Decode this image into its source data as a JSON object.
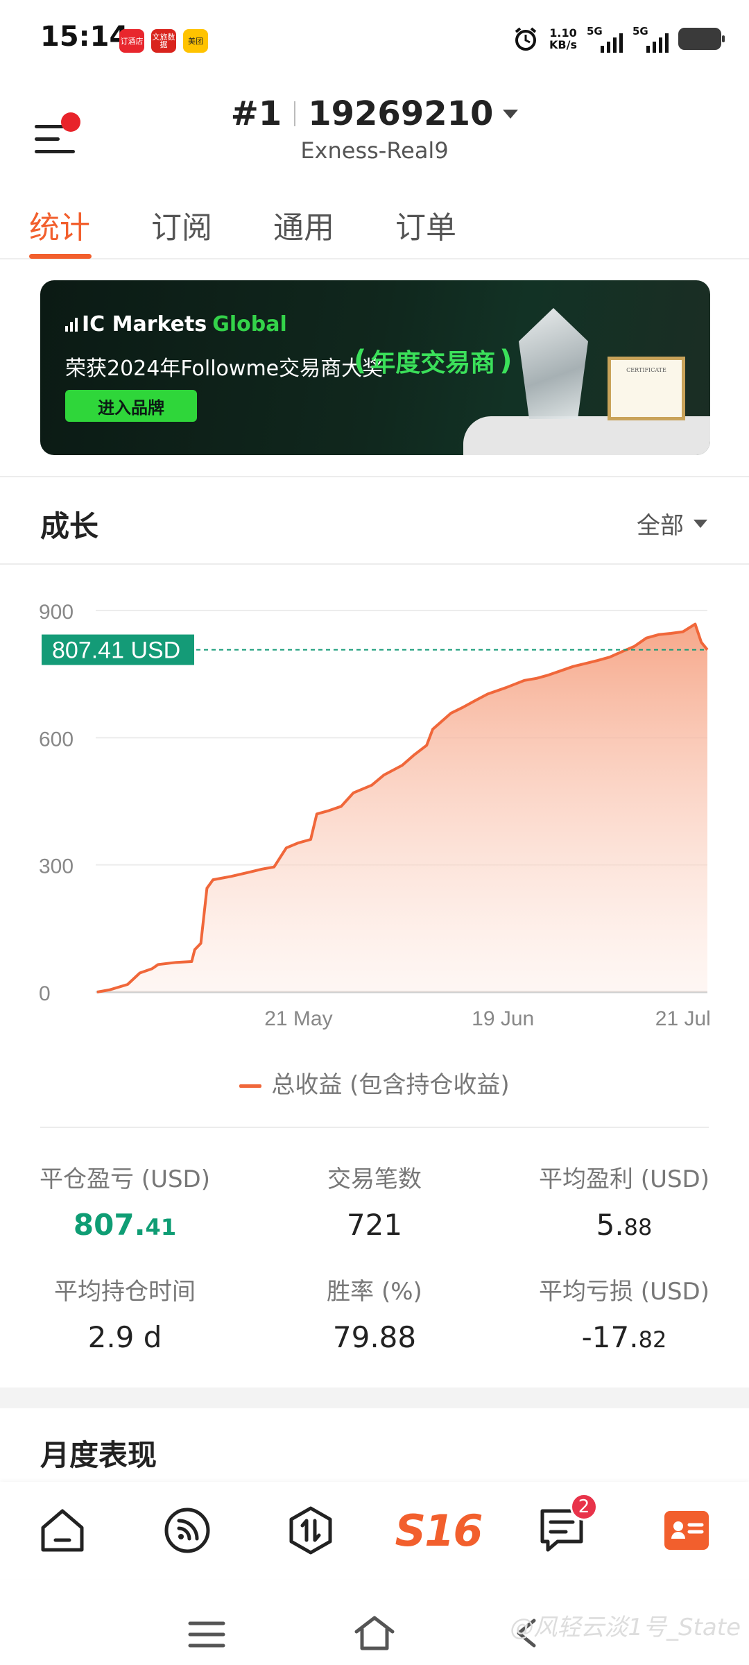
{
  "status_bar": {
    "time": "15:14",
    "apps": [
      {
        "name": "订酒店",
        "color": "#e8262d"
      },
      {
        "name": "文旅数据",
        "color": "#d9241d"
      },
      {
        "name": "美团",
        "color": "#ffc300"
      }
    ],
    "net_speed_value": "1.10",
    "net_speed_unit": "KB/s",
    "sim1": "5G",
    "sim2": "5G"
  },
  "header": {
    "account_index": "#1",
    "account_number": "19269210",
    "server": "Exness-Real9"
  },
  "tabs": [
    {
      "label": "统计",
      "active": true
    },
    {
      "label": "订阅",
      "active": false
    },
    {
      "label": "通用",
      "active": false
    },
    {
      "label": "订单",
      "active": false
    }
  ],
  "banner": {
    "brand_prefix": "IC Markets",
    "brand_suffix": "Global",
    "text": "荣获2024年Followme交易商大奖",
    "award": "年度交易商",
    "button": "进入品牌",
    "certificate_title": "CERTIFICATE"
  },
  "growth": {
    "title": "成长",
    "filter": "全部",
    "current_label": "807.41 USD",
    "legend": "总收益 (包含持仓收益)"
  },
  "chart_data": {
    "type": "area",
    "y_ticks": [
      0,
      300,
      600,
      900
    ],
    "ylim": [
      0,
      900
    ],
    "x_tick_labels": [
      "21 May",
      "19 Jun",
      "21 Jul"
    ],
    "x_tick_positions": [
      0.33,
      0.665,
      0.96
    ],
    "current_value": 807.41,
    "series": [
      {
        "name": "总收益 (包含持仓收益)",
        "color": "#f0673a",
        "points": [
          [
            0.0,
            0
          ],
          [
            0.02,
            5
          ],
          [
            0.05,
            18
          ],
          [
            0.07,
            45
          ],
          [
            0.09,
            55
          ],
          [
            0.1,
            65
          ],
          [
            0.13,
            70
          ],
          [
            0.155,
            72
          ],
          [
            0.16,
            100
          ],
          [
            0.17,
            115
          ],
          [
            0.18,
            245
          ],
          [
            0.19,
            265
          ],
          [
            0.22,
            273
          ],
          [
            0.25,
            283
          ],
          [
            0.27,
            290
          ],
          [
            0.29,
            295
          ],
          [
            0.31,
            340
          ],
          [
            0.33,
            352
          ],
          [
            0.35,
            360
          ],
          [
            0.36,
            420
          ],
          [
            0.38,
            428
          ],
          [
            0.4,
            438
          ],
          [
            0.42,
            470
          ],
          [
            0.45,
            488
          ],
          [
            0.47,
            512
          ],
          [
            0.5,
            535
          ],
          [
            0.52,
            560
          ],
          [
            0.54,
            582
          ],
          [
            0.55,
            620
          ],
          [
            0.58,
            658
          ],
          [
            0.6,
            672
          ],
          [
            0.62,
            688
          ],
          [
            0.64,
            703
          ],
          [
            0.67,
            718
          ],
          [
            0.7,
            735
          ],
          [
            0.72,
            740
          ],
          [
            0.74,
            748
          ],
          [
            0.76,
            758
          ],
          [
            0.78,
            768
          ],
          [
            0.8,
            775
          ],
          [
            0.82,
            782
          ],
          [
            0.84,
            790
          ],
          [
            0.86,
            803
          ],
          [
            0.88,
            815
          ],
          [
            0.9,
            835
          ],
          [
            0.92,
            843
          ],
          [
            0.94,
            846
          ],
          [
            0.96,
            850
          ],
          [
            0.98,
            868
          ],
          [
            0.99,
            825
          ],
          [
            1.0,
            807.41
          ]
        ]
      }
    ]
  },
  "stats": [
    {
      "label": "平仓盈亏 (USD)",
      "value_main": "807.",
      "value_small": "41",
      "positive": true
    },
    {
      "label": "交易笔数",
      "value_main": "721",
      "value_small": "",
      "positive": false
    },
    {
      "label": "平均盈利 (USD)",
      "value_main": "5.",
      "value_small": "88",
      "positive": false
    },
    {
      "label": "平均持仓时间",
      "value_main": "2.9 d",
      "value_small": "",
      "positive": false
    },
    {
      "label": "胜率 (%)",
      "value_main": "79.88",
      "value_small": "",
      "positive": false
    },
    {
      "label": "平均亏损 (USD)",
      "value_main": "-17.",
      "value_small": "82",
      "positive": false
    }
  ],
  "monthly": {
    "title": "月度表现"
  },
  "bottom_nav": {
    "items": [
      "home-icon",
      "feed-icon",
      "trade-icon",
      "s16-logo",
      "messages-icon",
      "profile-card-icon"
    ],
    "logo_text": "S16",
    "messages_badge": "2"
  },
  "watermark": "@风轻云淡1号_State",
  "colors": {
    "accent": "#f25f2d",
    "positive": "#0f9d74",
    "chart_line": "#f0673a"
  }
}
